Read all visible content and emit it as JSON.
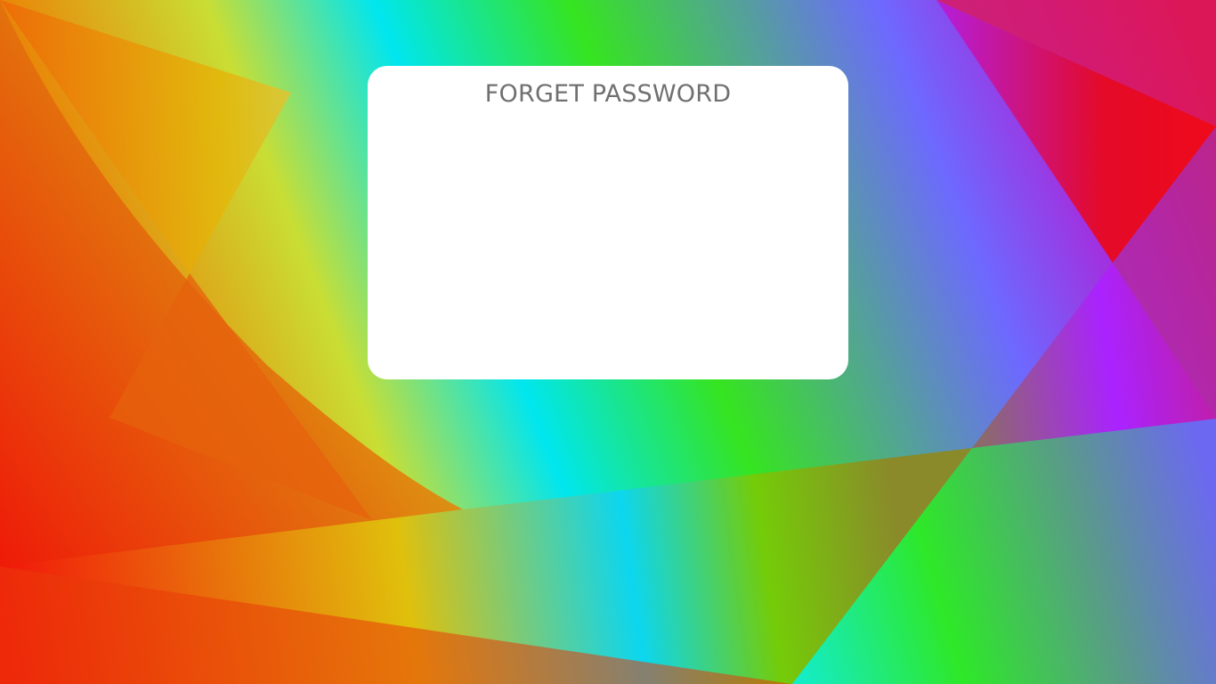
{
  "dialog": {
    "title": "FORGET PASSWORD"
  },
  "theme": {
    "card_background": "#ffffff",
    "title_color": "#707070",
    "background_palette": [
      "#f01a0c",
      "#e8890a",
      "#e0c80c",
      "#00e4f0",
      "#33e622",
      "#6e6aff",
      "#aa22ff",
      "#e80a28"
    ]
  }
}
